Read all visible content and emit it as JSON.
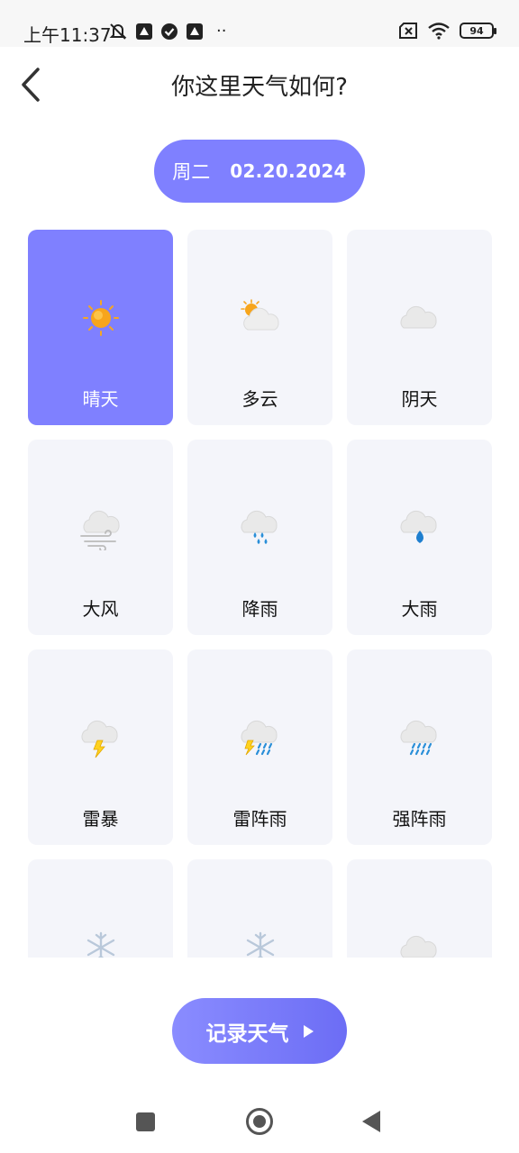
{
  "status_bar": {
    "time": "上午11:37",
    "dots": "··",
    "battery": "94",
    "icons_left": [
      "mute-bell-icon",
      "app-icon",
      "check-circle-icon",
      "app-icon"
    ],
    "icons_right": [
      "sim-missing-icon",
      "wifi-icon",
      "battery-icon"
    ]
  },
  "header": {
    "title": "你这里天气如何?",
    "back_icon": "chevron-left-icon"
  },
  "date": {
    "weekday": "周二",
    "value": "02.20.2024"
  },
  "weather": [
    {
      "label": "晴天",
      "icon": "sunny-icon",
      "selected": true
    },
    {
      "label": "多云",
      "icon": "partly-cloudy-icon",
      "selected": false
    },
    {
      "label": "阴天",
      "icon": "overcast-icon",
      "selected": false
    },
    {
      "label": "大风",
      "icon": "windy-icon",
      "selected": false
    },
    {
      "label": "降雨",
      "icon": "rain-icon",
      "selected": false
    },
    {
      "label": "大雨",
      "icon": "heavy-rain-icon",
      "selected": false
    },
    {
      "label": "雷暴",
      "icon": "thunderstorm-icon",
      "selected": false
    },
    {
      "label": "雷阵雨",
      "icon": "thunder-shower-icon",
      "selected": false
    },
    {
      "label": "强阵雨",
      "icon": "heavy-shower-icon",
      "selected": false
    },
    {
      "label": "",
      "icon": "snow-icon",
      "selected": false
    },
    {
      "label": "",
      "icon": "snow-icon",
      "selected": false
    },
    {
      "label": "",
      "icon": "cloud-icon",
      "selected": false
    }
  ],
  "record_button": {
    "label": "记录天气"
  },
  "colors": {
    "accent": "#7f80ff",
    "card_bg": "#f4f5fa"
  }
}
